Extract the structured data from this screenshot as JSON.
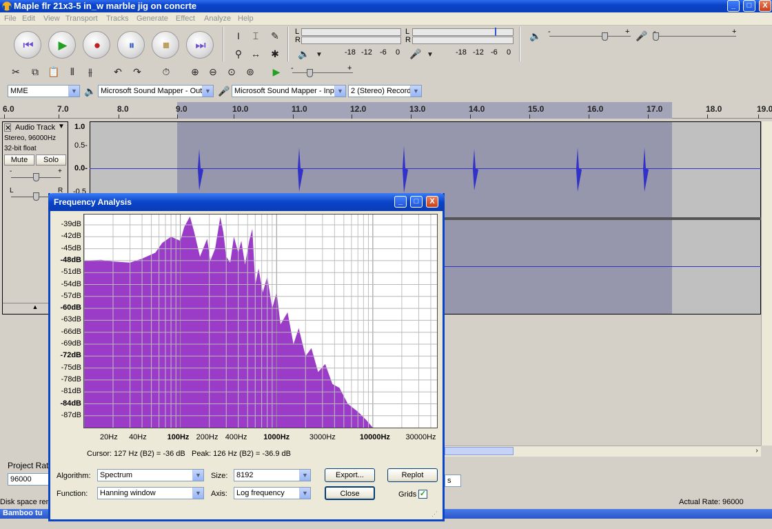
{
  "window": {
    "title": "Maple flr 21x3-5 in_w marble jig on concrte",
    "btn_minimize": "_",
    "btn_maximize": "□",
    "btn_close": "X"
  },
  "menu": [
    "File",
    "Edit",
    "View",
    "Transport",
    "Tracks",
    "Generate",
    "Effect",
    "Analyze",
    "Help"
  ],
  "meters": {
    "play_channels": [
      "L",
      "R"
    ],
    "rec_channels": [
      "L",
      "R"
    ],
    "scale_play": [
      "-18",
      "-12",
      "-6",
      "0"
    ],
    "scale_rec": [
      "-18",
      "-12",
      "-6",
      "0"
    ],
    "slider_minus": "-",
    "slider_plus": "+"
  },
  "devices": {
    "host": "MME",
    "output": "Microsoft Sound Mapper - Outp",
    "input": "Microsoft Sound Mapper - Inpu",
    "channels": "2 (Stereo) Record"
  },
  "ruler": {
    "labels": [
      "6.0",
      "7.0",
      "8.0",
      "9.0",
      "10.0",
      "11.0",
      "12.0",
      "13.0",
      "14.0",
      "15.0",
      "16.0",
      "17.0",
      "18.0",
      "19.0"
    ]
  },
  "track": {
    "name": "Audio Track",
    "info1": "Stereo, 96000Hz",
    "info2": "32-bit float",
    "mute": "Mute",
    "solo": "Solo",
    "gain_minus": "-",
    "gain_plus": "+",
    "pan_left": "L",
    "pan_right": "R",
    "scale": [
      "1.0",
      "0.5-",
      "0.0-",
      "-0.5"
    ]
  },
  "bottom": {
    "project_rate_label": "Project Rate",
    "project_rate_value": "96000",
    "snap_unit": "s",
    "disk_space": "Disk space rem",
    "actual_rate": "Actual Rate: 96000",
    "taskbar_item": "Bamboo tu"
  },
  "dialog": {
    "title": "Frequency Analysis",
    "btn_minimize": "_",
    "btn_maximize": "□",
    "btn_close": "X",
    "y_labels": [
      "-39dB",
      "-42dB",
      "-45dB",
      "-48dB",
      "-51dB",
      "-54dB",
      "-57dB",
      "-60dB",
      "-63dB",
      "-66dB",
      "-69dB",
      "-72dB",
      "-75dB",
      "-78dB",
      "-81dB",
      "-84dB",
      "-87dB"
    ],
    "y_bold": [
      "-48dB",
      "-60dB",
      "-72dB",
      "-84dB"
    ],
    "x_labels": [
      "20Hz",
      "40Hz",
      "100Hz",
      "200Hz",
      "400Hz",
      "1000Hz",
      "3000Hz",
      "10000Hz",
      "30000Hz"
    ],
    "x_bold": [
      "100Hz",
      "1000Hz",
      "10000Hz"
    ],
    "cursor_text": "Cursor: 127 Hz (B2) = -36 dB",
    "peak_text": "Peak: 126 Hz (B2) = -36.9 dB",
    "algorithm_label": "Algorithm:",
    "algorithm_value": "Spectrum",
    "function_label": "Function:",
    "function_value": "Hanning window",
    "size_label": "Size:",
    "size_value": "8192",
    "axis_label": "Axis:",
    "axis_value": "Log frequency",
    "export_label": "Export...",
    "replot_label": "Replot",
    "close_label": "Close",
    "grids_label": "Grids",
    "grids_checked": true,
    "spectrum_color": "#9a3cc8"
  }
}
